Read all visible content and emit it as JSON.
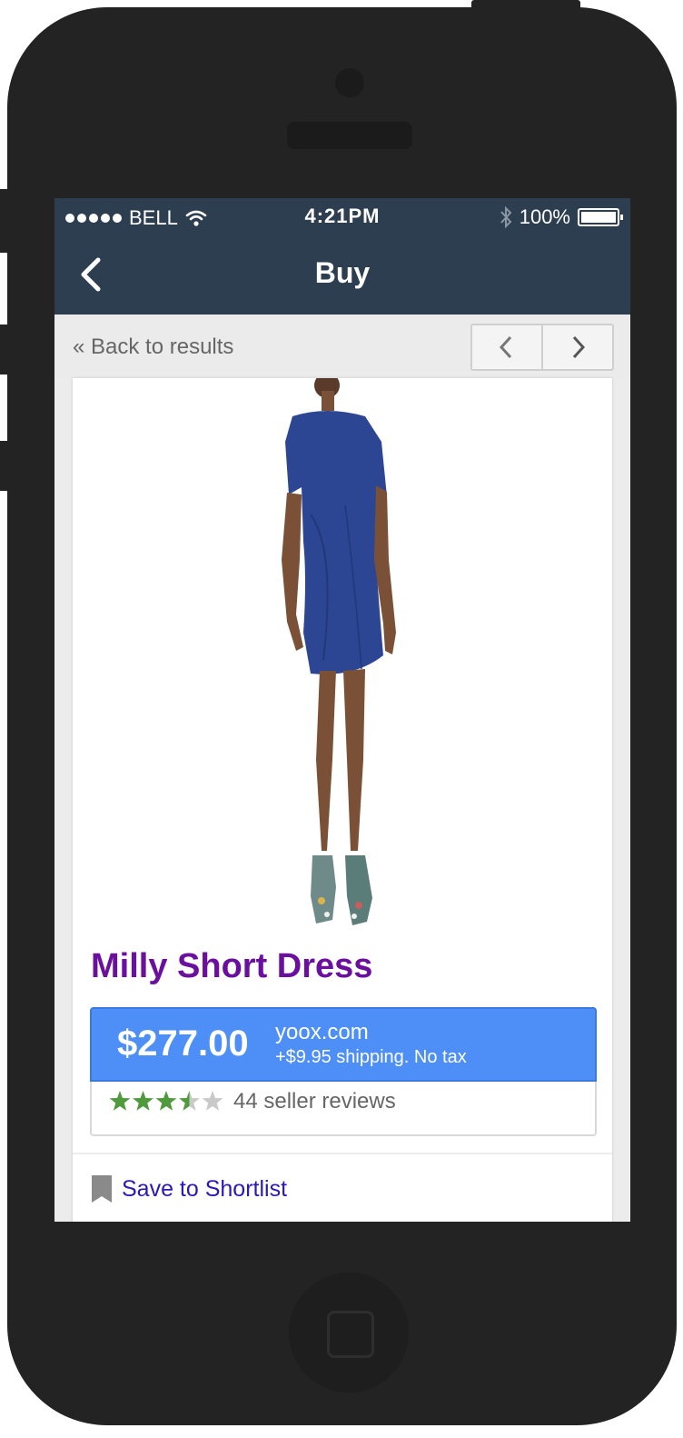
{
  "status_bar": {
    "carrier": "BELL",
    "time": "4:21PM",
    "battery": "100%"
  },
  "navbar": {
    "title": "Buy"
  },
  "results_nav": {
    "back_label": "« Back to results"
  },
  "product": {
    "title": "Milly Short Dress",
    "price": "$277.00",
    "merchant": "yoox.com",
    "shipping": "+$9.95 shipping. No tax",
    "rating": 3.5,
    "reviews": "44 seller reviews",
    "save_label": "Save to Shortlist"
  },
  "colors": {
    "header_bg": "#2c3e50",
    "title_purple": "#6b0f9e",
    "price_blue": "#4d8ef7",
    "star_green": "#4e9a3c",
    "link_blue": "#2a1ab5"
  }
}
